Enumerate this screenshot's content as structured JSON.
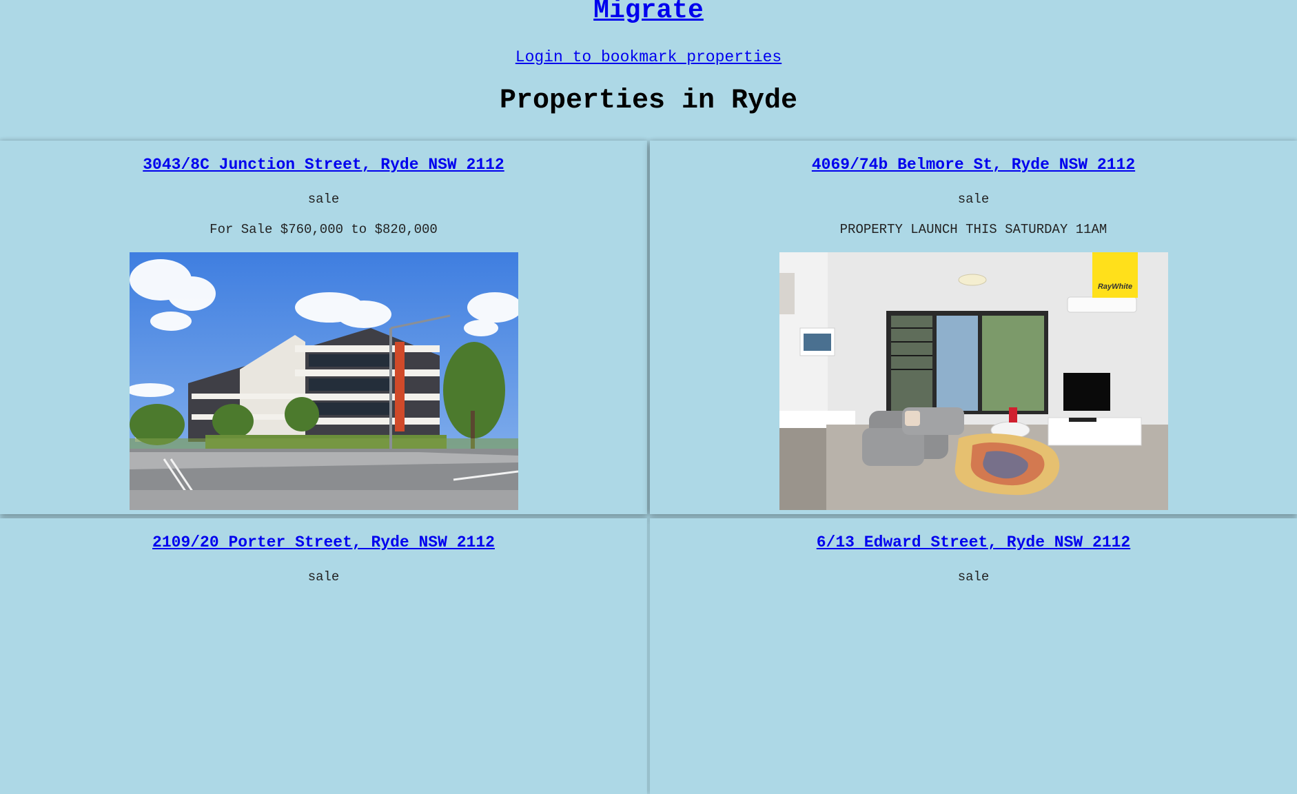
{
  "site": {
    "title": "Migrate",
    "login_link": "Login to bookmark properties",
    "heading": "Properties in Ryde"
  },
  "listings": [
    {
      "address": "3043/8C Junction Street, Ryde NSW 2112",
      "type": "sale",
      "description": "For Sale $760,000 to $820,000",
      "photo": "apartment-building-exterior"
    },
    {
      "address": "4069/74b Belmore St, Ryde NSW 2112",
      "type": "sale",
      "description": "PROPERTY LAUNCH THIS SATURDAY 11AM",
      "photo": "living-room-interior",
      "photo_badge": "RayWhite"
    },
    {
      "address": "2109/20 Porter Street, Ryde NSW 2112",
      "type": "sale"
    },
    {
      "address": "6/13 Edward Street, Ryde NSW 2112",
      "type": "sale"
    }
  ],
  "colors": {
    "background": "#add8e6",
    "link": "#0000ee",
    "badge": "#ffe01b"
  }
}
